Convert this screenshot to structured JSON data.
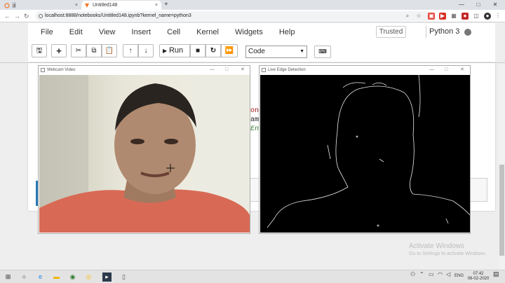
{
  "browser": {
    "tabs": [
      {
        "label": "jjj",
        "close": "×"
      },
      {
        "label": "Untitled148",
        "close": "×"
      }
    ],
    "new_tab": "+",
    "window_controls": {
      "minimize": "—",
      "maximize": "□",
      "close": "✕"
    },
    "nav": {
      "back": "←",
      "forward": "→",
      "reload": "↻"
    },
    "url": "localhost:8888/notebooks/Untitled148.ipynb?kernel_name=python3"
  },
  "notebook": {
    "menu": [
      "File",
      "Edit",
      "View",
      "Insert",
      "Cell",
      "Kernel",
      "Widgets",
      "Help"
    ],
    "trusted_label": "Trusted",
    "kernel_label": "Python 3",
    "toolbar": {
      "save": "🖫",
      "add": "+",
      "cut": "✂",
      "copy": "⧉",
      "paste": "📋",
      "up": "↑",
      "down": "↓",
      "run": "Run",
      "run_icon": "▶",
      "stop": "■",
      "restart": "↻",
      "fast_forward": "⏩",
      "cell_type": "Code",
      "keyboard": "⌨"
    },
    "code_fragments": [
      "on",
      "am",
      "En"
    ]
  },
  "windows": {
    "webcam": {
      "title": "Webcam Video"
    },
    "edge": {
      "title": "Live Edge Detection"
    },
    "controls": {
      "minimize": "—",
      "maximize": "□",
      "close": "✕"
    }
  },
  "watermark": {
    "title": "Activate Windows",
    "subtitle": "Go to Settings to activate Windows."
  },
  "taskbar": {
    "language": "ENG",
    "time": "07:42",
    "date": "08-02-2020"
  },
  "colors": {
    "kernel_dot": "#777777",
    "code_red": "#a11111",
    "code_green": "#3b7a3b",
    "accent_blue": "#2a7ab8"
  }
}
